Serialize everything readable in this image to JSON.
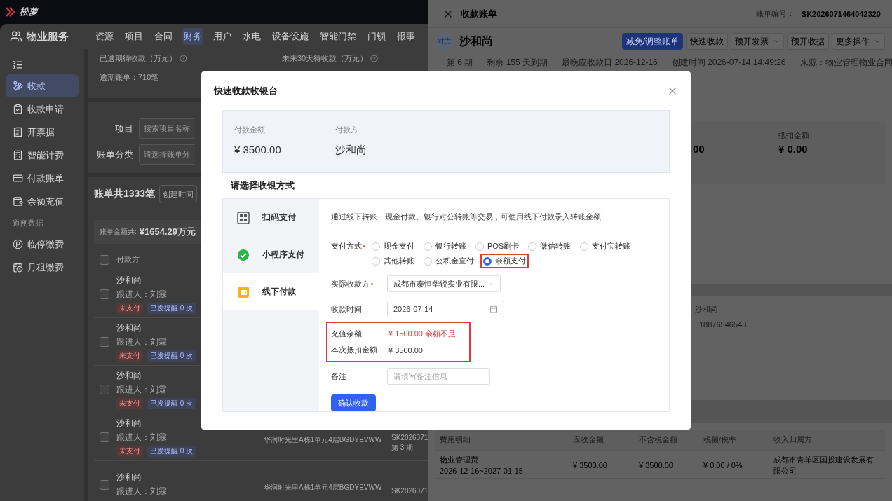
{
  "app": {
    "logo": "松萝",
    "module": "物业服务",
    "nav": [
      {
        "label": "资源",
        "selected": false
      },
      {
        "label": "项目",
        "selected": false
      },
      {
        "label": "合同",
        "selected": false
      },
      {
        "label": "财务",
        "selected": true
      },
      {
        "label": "用户",
        "selected": false
      },
      {
        "label": "水电",
        "selected": false
      },
      {
        "label": "设备设施",
        "selected": false
      },
      {
        "label": "智能门禁",
        "selected": false
      },
      {
        "label": "门锁",
        "selected": false
      },
      {
        "label": "报事",
        "selected": false
      }
    ],
    "sidebar": {
      "items": [
        {
          "label": "收款",
          "selected": true
        },
        {
          "label": "收款申请",
          "selected": false
        },
        {
          "label": "开票据",
          "selected": false
        },
        {
          "label": "智能计费",
          "selected": false
        },
        {
          "label": "付款账单",
          "selected": false
        },
        {
          "label": "余额充值",
          "selected": false
        }
      ],
      "section": "道闸数据",
      "section_items": [
        {
          "label": "临停缴费",
          "selected": false
        },
        {
          "label": "月租缴费",
          "selected": false
        }
      ]
    },
    "stats": [
      {
        "label": "已逾期待收款（万元）",
        "note": "逾期账单：710笔"
      },
      {
        "label": "未来30天待收款（万元）"
      }
    ],
    "filters": [
      {
        "label": "项目",
        "placeholder": "搜索项目名称"
      },
      {
        "label": "账单分类",
        "placeholder": "请选择账单分"
      }
    ],
    "list": {
      "count": "账单共1333笔",
      "sort": "创建时间",
      "total_label": "账单金额共:",
      "total": "¥1654.29万元",
      "header": {
        "label": "付款方",
        "checked": false
      },
      "rows": [
        {
          "payer": "沙和尚",
          "follower": "跟进人：刘霖",
          "checked": false,
          "tags": [
            {
              "label": "未支付",
              "kind": "danger"
            },
            {
              "label": "已发提醒 0 次",
              "kind": "info"
            }
          ]
        },
        {
          "payer": "沙和尚",
          "follower": "跟进人：刘霖",
          "checked": false,
          "tags": [
            {
              "label": "未支付",
              "kind": "danger"
            },
            {
              "label": "已发提醒 0 次",
              "kind": "info"
            }
          ]
        },
        {
          "payer": "沙和尚",
          "follower": "跟进人：刘霖",
          "checked": false,
          "tags": [
            {
              "label": "未支付",
              "kind": "danger"
            },
            {
              "label": "已发提醒 0 次",
              "kind": "info"
            }
          ]
        },
        {
          "payer": "沙和尚",
          "follower": "跟进人：刘霖",
          "checked": false,
          "tags": [
            {
              "label": "未支付",
              "kind": "danger"
            },
            {
              "label": "已发提醒 0 次",
              "kind": "info"
            }
          ],
          "address": "华润时光里A栋1单元4层BGDYEVWW",
          "code": "SK2026071",
          "period": "第 3 期"
        },
        {
          "payer": "沙和尚",
          "follower": "跟进人：刘霖",
          "checked": false,
          "address": "华润时光里A栋1单元4层BGDYEVWW",
          "code": "SK2026071"
        }
      ]
    }
  },
  "drawer": {
    "title": "收款账单",
    "bill_no_label": "账单编号：",
    "bill_no": "SK2026071464042320",
    "avatar": "对方",
    "payer": "沙和尚",
    "actions": [
      {
        "label": "减免/调整账单",
        "kind": "primary"
      },
      {
        "label": "快速收款",
        "kind": "default"
      },
      {
        "label": "预开发票",
        "kind": "dropdown"
      },
      {
        "label": "预开收据",
        "kind": "default"
      },
      {
        "label": "更多操作",
        "kind": "dropdown"
      }
    ],
    "meta": [
      "第 6 期",
      "剩余 155 天到期",
      "最晚应收款日 2026-12-16",
      "创建时间 2026-07-14 14:49:26",
      "来源：物业管理物业合同"
    ],
    "amounts": [
      {
        "value": "00"
      },
      {
        "label": "抵扣金额",
        "value": "¥ 0.00"
      }
    ],
    "contact": [
      "沙和尚",
      "18876546543"
    ],
    "fees": {
      "columns": [
        "费用明细",
        "应收金额",
        "不含税金额",
        "税额/税率",
        "收入归属方"
      ],
      "rows": [
        {
          "item": "物业管理费",
          "period": "2026-12-16~2027-01-15",
          "receivable": "¥ 3500.00",
          "untaxed": "¥ 3500.00",
          "tax": "¥ 0.00 / 0%",
          "owner": "成都市青羊区国投建设发展有限公司"
        }
      ]
    }
  },
  "modal": {
    "title": "快速收款收银台",
    "summary": [
      {
        "label": "付款金额",
        "value": "¥ 3500.00"
      },
      {
        "label": "付款方",
        "value": "沙和尚"
      }
    ],
    "section_title": "请选择收银方式",
    "methods": [
      {
        "label": "扫码支付",
        "selected": false
      },
      {
        "label": "小程序支付",
        "selected": false
      },
      {
        "label": "线下付款",
        "selected": true
      }
    ],
    "description": "通过线下转账、现金付款、银行对公转账等交易，可使用线下付款录入转账金额",
    "pay_type": {
      "label": "支付方式",
      "required": true,
      "options": [
        {
          "label": "现金支付",
          "selected": false,
          "highlighted": false
        },
        {
          "label": "银行转账",
          "selected": false,
          "highlighted": false
        },
        {
          "label": "POS刷卡",
          "selected": false,
          "highlighted": false
        },
        {
          "label": "微信转账",
          "selected": false,
          "highlighted": false
        },
        {
          "label": "支付宝转账",
          "selected": false,
          "highlighted": false
        },
        {
          "label": "其他转账",
          "selected": false,
          "highlighted": false
        },
        {
          "label": "公积金直付",
          "selected": false,
          "highlighted": false
        },
        {
          "label": "余额支付",
          "selected": true,
          "highlighted": true
        }
      ]
    },
    "payee": {
      "label": "实际收款方",
      "required": true,
      "value": "成都市泰恒华锐实业有限..."
    },
    "date": {
      "label": "收款时间",
      "value": "2026-07-14"
    },
    "balance": {
      "highlighted": true,
      "rows": [
        {
          "label": "充值余额",
          "value": "¥ 1500.00 余额不足",
          "kind": "warning"
        },
        {
          "label": "本次抵扣金额",
          "value": "¥ 3500.00",
          "kind": "normal"
        }
      ]
    },
    "remark": {
      "label": "备注",
      "placeholder": "请填写备注信息"
    },
    "submit": "确认收款"
  }
}
